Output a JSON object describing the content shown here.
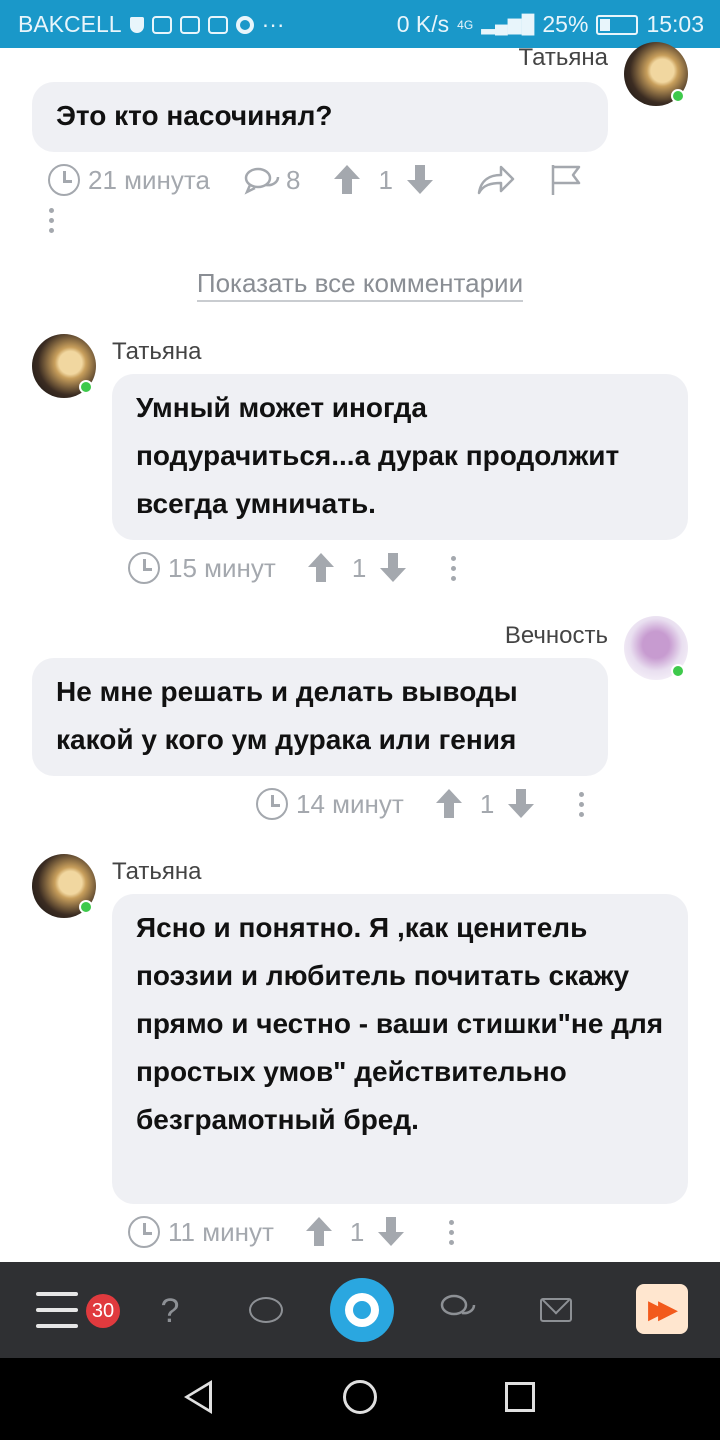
{
  "status_bar": {
    "carrier": "BAKCELL",
    "net_speed": "0 K/s",
    "signal": "4G",
    "battery": "25%",
    "time": "15:03"
  },
  "comments": [
    {
      "author": "Татьяна",
      "text": "Это кто насочинял?",
      "time": "21 минута",
      "replies": "8",
      "rating": "1"
    },
    {
      "author": "Татьяна",
      "text": "Умный может иногда подурачиться...а дурак продолжит всегда умничать.",
      "time": "15 минут",
      "rating": "1"
    },
    {
      "author": "Вечность",
      "text": "Не мне решать и делать выводы какой у кого ум дурака или гения",
      "time": "14 минут",
      "rating": "1"
    },
    {
      "author": "Татьяна",
      "text": "Ясно и понятно. Я ,как ценитель поэзии и любитель почитать скажу прямо и честно - ваши стишки\"не для простых умов\" действительно безграмотный бред.",
      "time": "11 минут",
      "rating": "1"
    }
  ],
  "show_all_link": "Показать все комментарии",
  "bottom_nav": {
    "menu_badge": "30",
    "help_glyph": "?",
    "icons": [
      "menu-icon",
      "help-icon",
      "chat-icon",
      "app-logo-icon",
      "discussions-icon",
      "mail-icon",
      "fast-forward-icon"
    ]
  },
  "colors": {
    "status_bar": "#1a98c9",
    "bubble": "#eff0f4",
    "online": "#3ec94b",
    "badge": "#e03a3e",
    "logo": "#2aa7e0"
  }
}
